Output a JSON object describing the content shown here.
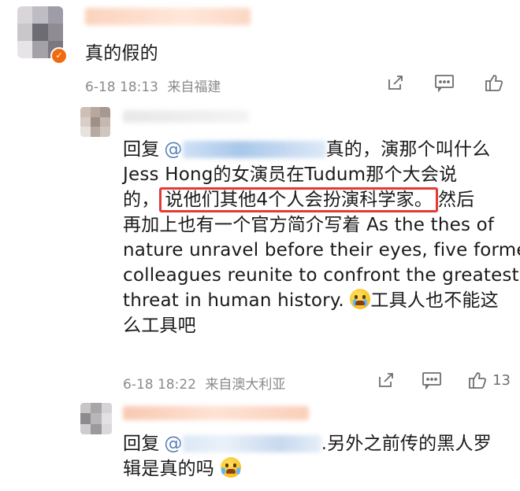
{
  "comment": {
    "text": "真的假的",
    "time": "6-18 18:13",
    "location": "来自福建"
  },
  "reply1": {
    "prefix": "回复",
    "at": "@",
    "line1_tail": "真的，演那个叫什么",
    "line2": "Jess Hong的女演员在Tudum那个大会说",
    "line3_pre": "的，",
    "line3_highlight": "说他们其他4个人会扮演科学家。",
    "line3_post": "然后",
    "line4": "再加上也有一个官方简介写着 As the thes of",
    "line5": "nature unravel before their eyes, five former",
    "line6": "colleagues reunite to confront the greatest",
    "line7_pre": "threat in human history.",
    "line7_post": "工具人也不能这",
    "line8": "么工具吧",
    "time": "6-18 18:22",
    "location": "来自澳大利亚",
    "like_count": "13"
  },
  "reply2": {
    "prefix": "回复",
    "at": "@",
    "line1_tail": ".另外之前传的黑人罗",
    "line2": "辑是真的吗"
  },
  "colors": {
    "highlight": "#e53935",
    "meta": "#8a8a8a",
    "vip": "#f26a10"
  },
  "icons": [
    "share-icon",
    "comment-icon",
    "like-icon"
  ]
}
